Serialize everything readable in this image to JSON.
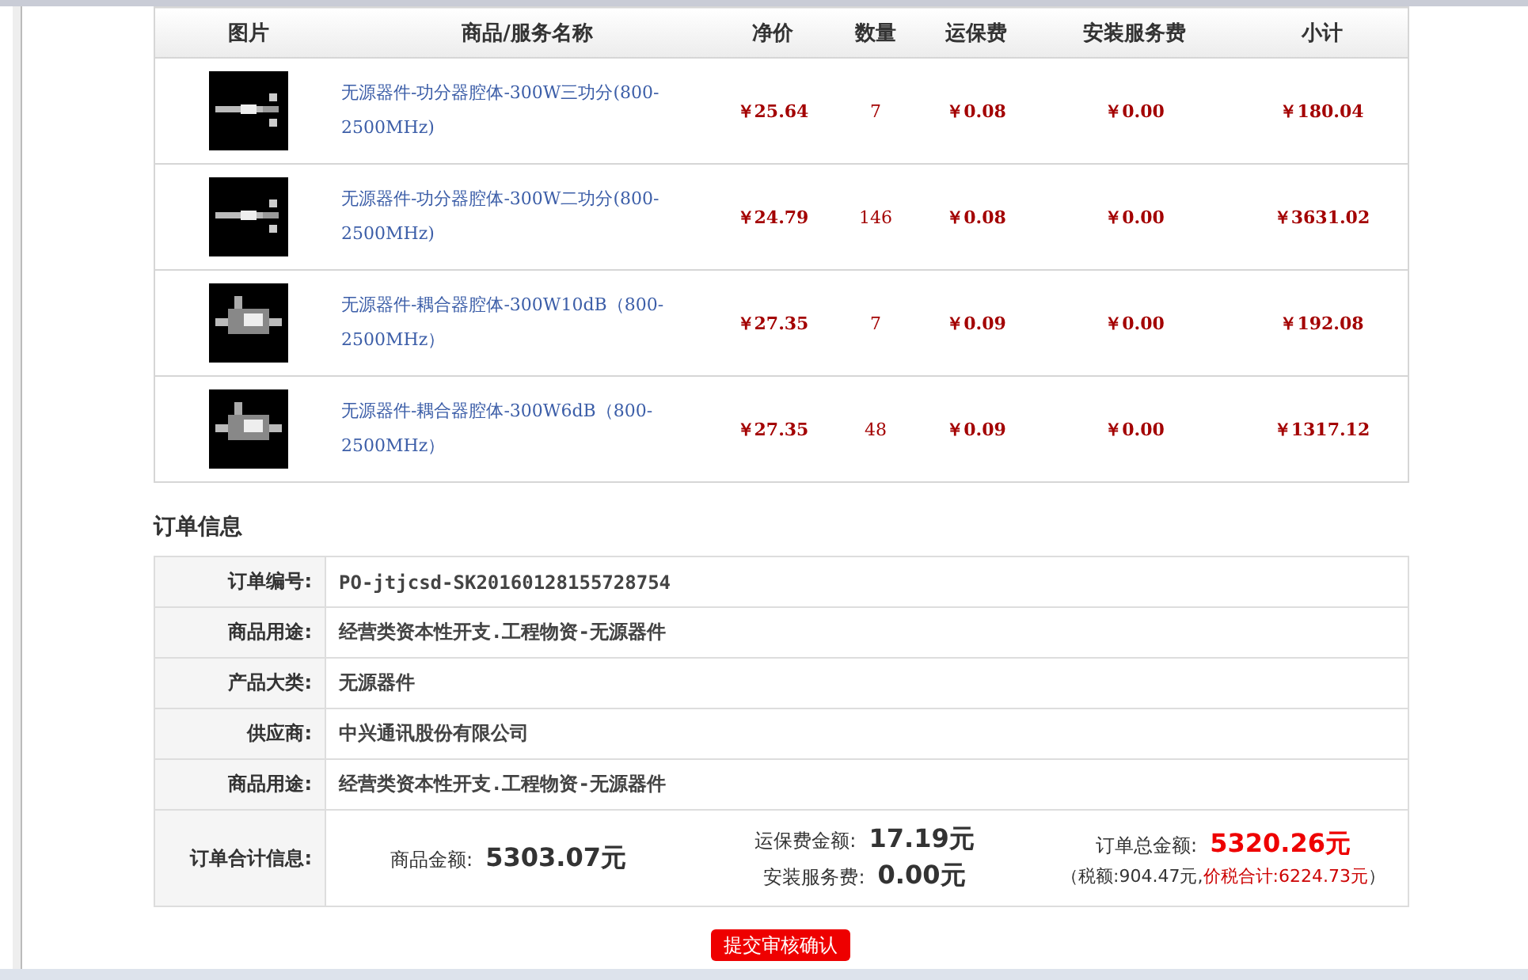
{
  "products": {
    "columns": [
      "图片",
      "商品/服务名称",
      "净价",
      "数量",
      "运保费",
      "安装服务费",
      "小计"
    ],
    "rows": [
      {
        "name": "无源器件-功分器腔体-300W三功分(800-2500MHz)",
        "price": "￥25.64",
        "quantity": "7",
        "shipping": "￥0.08",
        "install": "￥0.00",
        "subtotal": "￥180.04"
      },
      {
        "name": "无源器件-功分器腔体-300W二功分(800-2500MHz)",
        "price": "￥24.79",
        "quantity": "146",
        "shipping": "￥0.08",
        "install": "￥0.00",
        "subtotal": "￥3631.02"
      },
      {
        "name": "无源器件-耦合器腔体-300W10dB（800-2500MHz）",
        "price": "￥27.35",
        "quantity": "7",
        "shipping": "￥0.09",
        "install": "￥0.00",
        "subtotal": "￥192.08"
      },
      {
        "name": "无源器件-耦合器腔体-300W6dB（800-2500MHz）",
        "price": "￥27.35",
        "quantity": "48",
        "shipping": "￥0.09",
        "install": "￥0.00",
        "subtotal": "￥1317.12"
      }
    ]
  },
  "order_info": {
    "title": "订单信息",
    "fields": [
      {
        "label": "订单编号:",
        "value": "PO-jtjcsd-SK20160128155728754"
      },
      {
        "label": "商品用途:",
        "value": "经营类资本性开支.工程物资-无源器件"
      },
      {
        "label": "产品大类:",
        "value": "无源器件"
      },
      {
        "label": "供应商:",
        "value": "中兴通讯股份有限公司"
      },
      {
        "label": "商品用途:",
        "value": "经营类资本性开支.工程物资-无源器件"
      }
    ],
    "summary": {
      "label": "订单合计信息:",
      "goods_label": "商品金额:",
      "goods_value": "5303.07元",
      "shipping_label": "运保费金额:",
      "shipping_value": "17.19元",
      "install_label": "安装服务费:",
      "install_value": "0.00元",
      "total_label": "订单总金额:",
      "total_value": "5320.26元",
      "tax_prefix": "（税额:904.47元,",
      "tax_total": "价税合计:6224.73元",
      "tax_suffix": "）"
    }
  },
  "submit_button": {
    "label": "提交审核确认"
  }
}
